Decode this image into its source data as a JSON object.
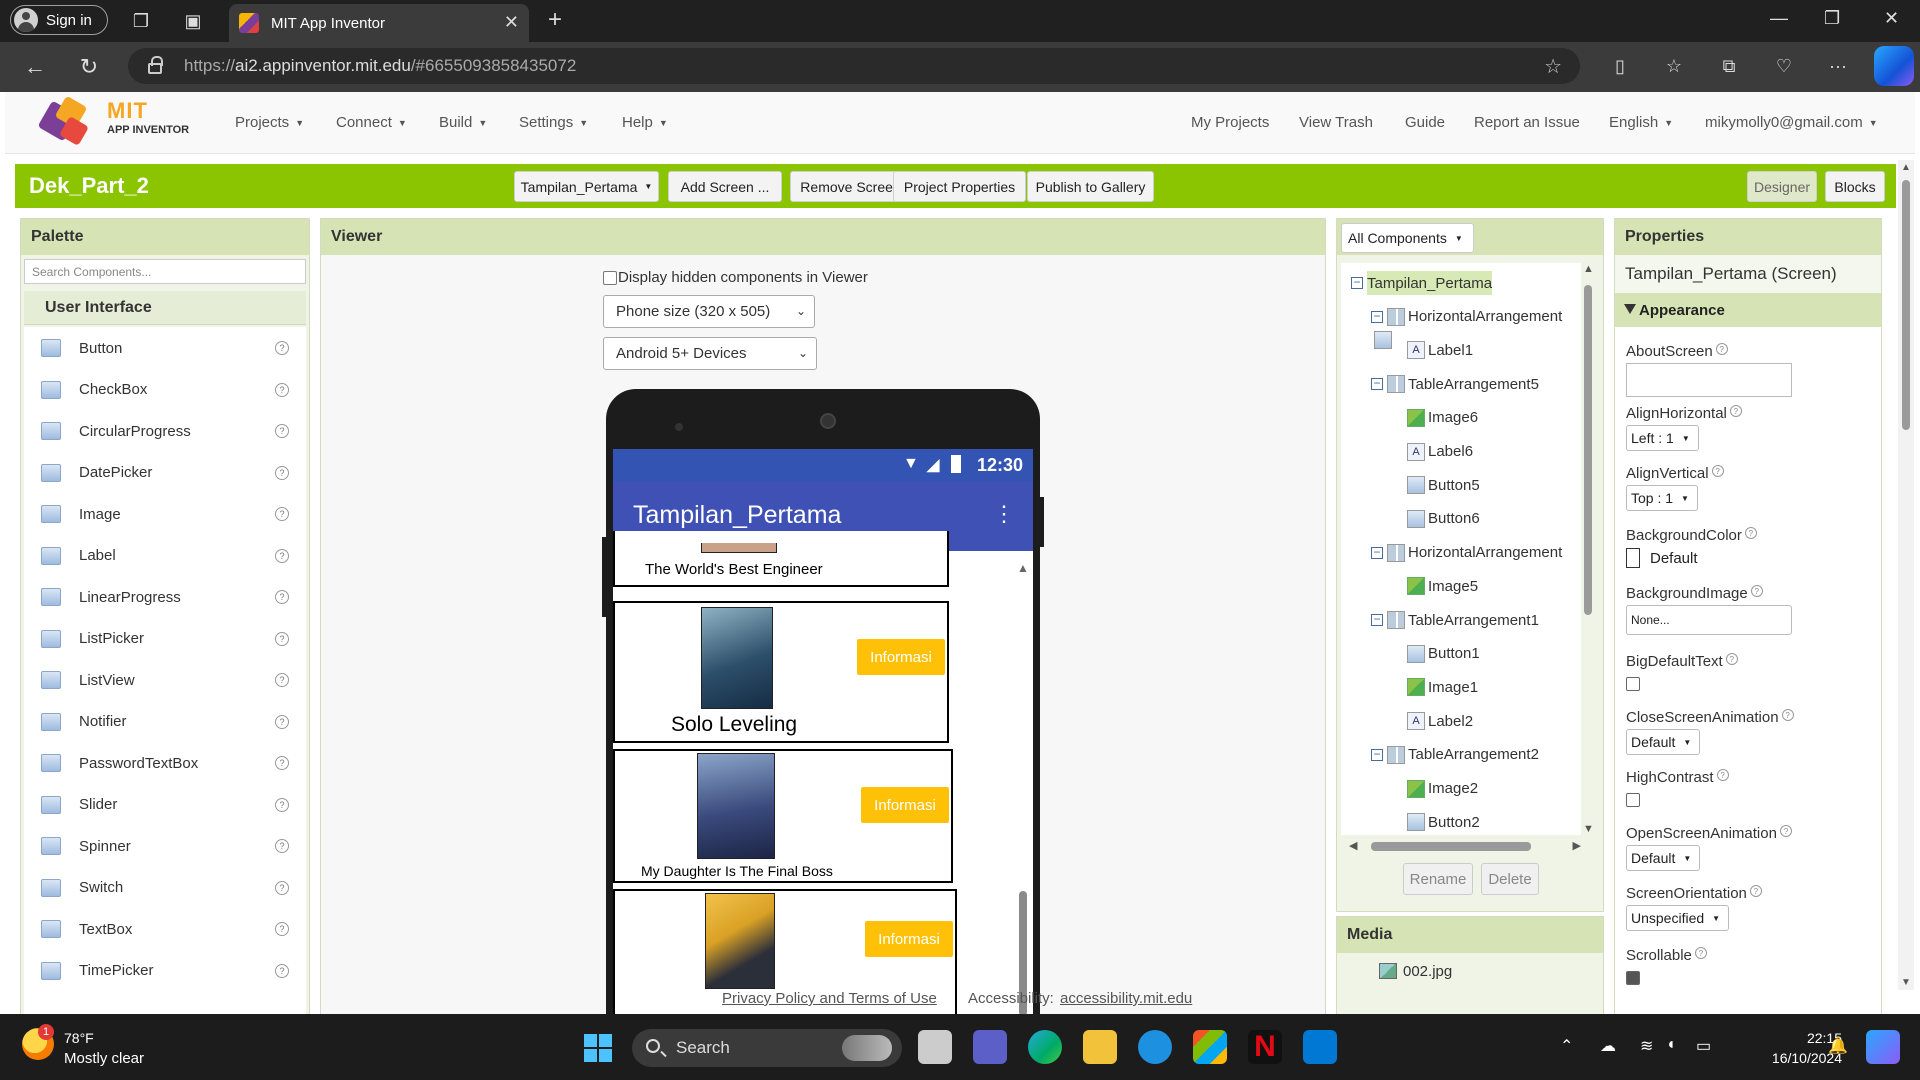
{
  "browser": {
    "signin_label": "Sign in",
    "tab_title": "MIT App Inventor",
    "url_prefix": "https://",
    "url_host": "ai2.appinventor.mit.edu",
    "url_path": "/#6655093858435072"
  },
  "app": {
    "logo_mit": "MIT",
    "logo_sub": "APP INVENTOR",
    "nav": [
      "Projects",
      "Connect",
      "Build",
      "Settings",
      "Help"
    ],
    "nav_right": [
      "My Projects",
      "View Trash",
      "Guide",
      "Report an Issue"
    ],
    "language": "English",
    "account": "mikymolly0@gmail.com",
    "project_name": "Dek_Part_2",
    "toolbar": {
      "screen_select": "Tampilan_Pertama",
      "add_screen": "Add Screen ...",
      "remove_screen": "Remove Screen",
      "project_properties": "Project Properties",
      "publish": "Publish to Gallery",
      "designer": "Designer",
      "blocks": "Blocks"
    }
  },
  "palette": {
    "title": "Palette",
    "search_placeholder": "Search Components...",
    "category": "User Interface",
    "items": [
      {
        "label": "Button",
        "icon": "button-icon"
      },
      {
        "label": "CheckBox",
        "icon": "checkbox-icon"
      },
      {
        "label": "CircularProgress",
        "icon": "circular-progress-icon"
      },
      {
        "label": "DatePicker",
        "icon": "datepicker-icon"
      },
      {
        "label": "Image",
        "icon": "image-icon"
      },
      {
        "label": "Label",
        "icon": "label-icon"
      },
      {
        "label": "LinearProgress",
        "icon": "linear-progress-icon"
      },
      {
        "label": "ListPicker",
        "icon": "listpicker-icon"
      },
      {
        "label": "ListView",
        "icon": "listview-icon"
      },
      {
        "label": "Notifier",
        "icon": "notifier-icon"
      },
      {
        "label": "PasswordTextBox",
        "icon": "password-icon"
      },
      {
        "label": "Slider",
        "icon": "slider-icon"
      },
      {
        "label": "Spinner",
        "icon": "spinner-icon"
      },
      {
        "label": "Switch",
        "icon": "switch-icon"
      },
      {
        "label": "TextBox",
        "icon": "textbox-icon"
      },
      {
        "label": "TimePicker",
        "icon": "timepicker-icon"
      }
    ],
    "help_glyph": "?"
  },
  "viewer": {
    "title": "Viewer",
    "hidden_toggle": "Display hidden components in Viewer",
    "size_select": "Phone size (320 x 505)",
    "device_select": "Android 5+ Devices",
    "status_time": "12:30",
    "screen_title": "Tampilan_Pertama",
    "menu_glyph": "⋮",
    "cards": [
      {
        "title": "The World's Best Engineer"
      },
      {
        "title": "Solo Leveling",
        "button": "Informasi"
      },
      {
        "title": "My Daughter Is The Final Boss",
        "button": "Informasi"
      },
      {
        "title": "",
        "button": "Informasi"
      }
    ]
  },
  "components": {
    "dropdown": "All Components",
    "tree": [
      {
        "label": "Tampilan_Pertama",
        "level": 0,
        "type": "screen",
        "toggle": "⊟"
      },
      {
        "label": "HorizontalArrangement",
        "level": 1,
        "type": "grp",
        "toggle": "⊟"
      },
      {
        "label": "Label1",
        "level": 2,
        "type": "lbl"
      },
      {
        "label": "TableArrangement5",
        "level": 1,
        "type": "grp",
        "toggle": "⊟"
      },
      {
        "label": "Image6",
        "level": 2,
        "type": "img"
      },
      {
        "label": "Label6",
        "level": 2,
        "type": "lbl"
      },
      {
        "label": "Button5",
        "level": 2,
        "type": "btn"
      },
      {
        "label": "Button6",
        "level": 2,
        "type": "btn"
      },
      {
        "label": "HorizontalArrangement",
        "level": 1,
        "type": "grp",
        "toggle": "⊟"
      },
      {
        "label": "Image5",
        "level": 2,
        "type": "img"
      },
      {
        "label": "TableArrangement1",
        "level": 1,
        "type": "grp",
        "toggle": "⊟"
      },
      {
        "label": "Button1",
        "level": 2,
        "type": "btn"
      },
      {
        "label": "Image1",
        "level": 2,
        "type": "img"
      },
      {
        "label": "Label2",
        "level": 2,
        "type": "lbl"
      },
      {
        "label": "TableArrangement2",
        "level": 1,
        "type": "grp",
        "toggle": "⊟"
      },
      {
        "label": "Image2",
        "level": 2,
        "type": "img"
      },
      {
        "label": "Button2",
        "level": 2,
        "type": "btn"
      }
    ],
    "rename": "Rename",
    "delete": "Delete"
  },
  "media": {
    "title": "Media",
    "items": [
      "002.jpg"
    ]
  },
  "properties": {
    "title": "Properties",
    "subject": "Tampilan_Pertama (Screen)",
    "group": "Appearance",
    "about_screen": "AboutScreen",
    "align_horizontal": "AlignHorizontal",
    "align_horizontal_value": "Left : 1",
    "align_vertical": "AlignVertical",
    "align_vertical_value": "Top : 1",
    "background_color": "BackgroundColor",
    "background_color_value": "Default",
    "background_image": "BackgroundImage",
    "background_image_value": "None...",
    "big_default_text": "BigDefaultText",
    "close_screen_animation": "CloseScreenAnimation",
    "close_screen_animation_value": "Default",
    "high_contrast": "HighContrast",
    "open_screen_animation": "OpenScreenAnimation",
    "open_screen_animation_value": "Default",
    "screen_orientation": "ScreenOrientation",
    "screen_orientation_value": "Unspecified",
    "scrollable": "Scrollable",
    "scrollable_checked": true,
    "help_glyph": "?"
  },
  "footer": {
    "privacy": "Privacy Policy and Terms of Use",
    "accessibility_label": "Accessibility:",
    "accessibility_link": "accessibility.mit.edu"
  },
  "taskbar": {
    "temperature": "78°F",
    "condition": "Mostly clear",
    "weather_badge": "1",
    "search": "Search",
    "time": "22:15",
    "date": "16/10/2024"
  },
  "colors": {
    "accent_green": "#8bc400",
    "panel_head": "#d6e4b5",
    "app_bar": "#3f51b5",
    "info_button": "#ffc107"
  }
}
